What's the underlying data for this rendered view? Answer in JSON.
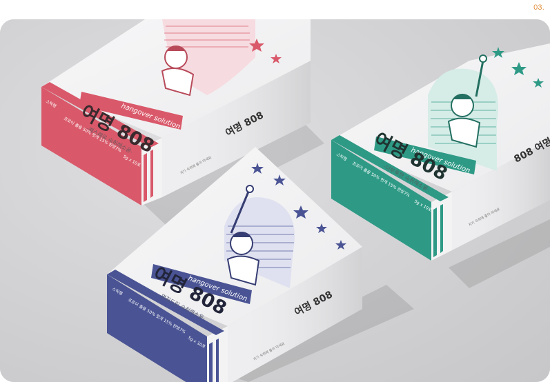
{
  "page_number": "03.",
  "products": [
    {
      "id": "red",
      "accent": "#d9596a",
      "side_color": "#e06677",
      "brand": "여명 808",
      "tagline": "hangover solution",
      "subtitle": "-페스레유 숙취해소용-",
      "label": "스틱형",
      "ingredients": "프로이 출용 50% 헛개 15% 한방7%",
      "quantity": "5g x 10포",
      "side_brand": "여명 808",
      "side_note": "지기 숙취에 좋아 마세요"
    },
    {
      "id": "green",
      "accent": "#2e9a86",
      "side_color": "#3aa590",
      "brand": "여명 808",
      "tagline": "hangover solution",
      "subtitle": "-더부룩한 숙취해소용-",
      "label": "스틱형",
      "ingredients": "프로이 출용 50% 헛개 15% 한방7%",
      "quantity": "5g x 10포",
      "side_brand": "808 여명",
      "side_note": "지기 숙취에 좋아 마세요"
    },
    {
      "id": "blue",
      "accent": "#4a5494",
      "side_color": "#5b64a4",
      "brand": "여명 808",
      "tagline": "hangover solution",
      "subtitle": "-명칭드린 숙취해소용-",
      "label": "스틱형",
      "ingredients": "프로이 출용 50% 헛개 15% 한방7%",
      "quantity": "5g x 10포",
      "side_brand": "여명 808",
      "side_note": "지기 숙취에 좋아 마세요"
    }
  ]
}
